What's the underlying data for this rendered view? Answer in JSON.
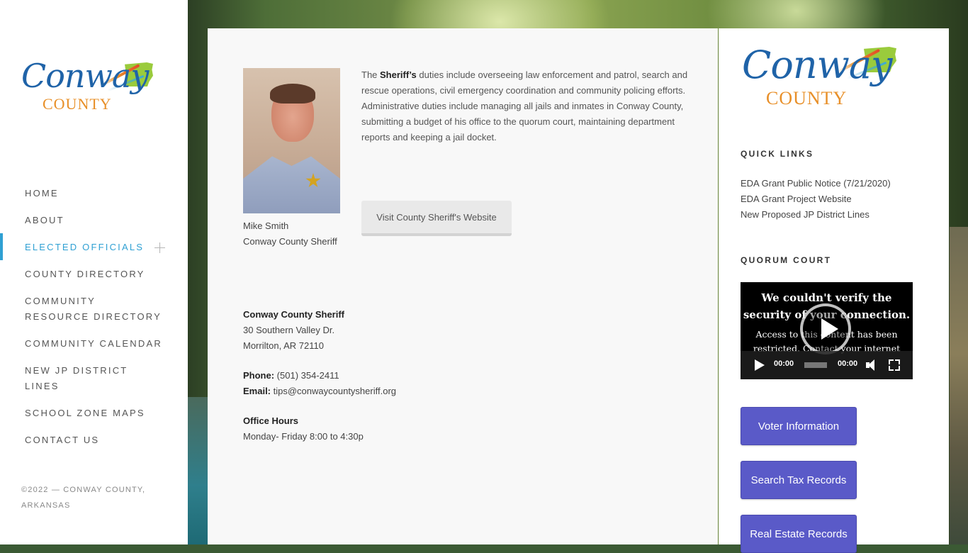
{
  "site": {
    "logo_script": "Conway",
    "logo_county": "COUNTY",
    "colors": {
      "accent": "#2fa0d3",
      "logo_blue": "#1f63a8",
      "logo_orange": "#e8902a",
      "button_blue": "#5a5ac8"
    }
  },
  "nav": {
    "items": [
      {
        "label": "HOME"
      },
      {
        "label": "ABOUT"
      },
      {
        "label": "ELECTED OFFICIALS",
        "active": true
      },
      {
        "label": "COUNTY DIRECTORY"
      },
      {
        "label": "COMMUNITY RESOURCE DIRECTORY"
      },
      {
        "label": "COMMUNITY CALENDAR"
      },
      {
        "label": "NEW JP DISTRICT LINES"
      },
      {
        "label": "SCHOOL ZONE MAPS"
      },
      {
        "label": "CONTACT US"
      }
    ]
  },
  "footer": {
    "copyright": "©2022 — CONWAY COUNTY, ARKANSAS"
  },
  "profile": {
    "name": "Mike Smith",
    "title": "Conway County Sheriff",
    "intro_prefix": "The ",
    "intro_bold": "Sheriff’s",
    "intro_rest": " duties include overseeing law enforcement and patrol, search and rescue operations, civil emergency coordination and community policing efforts. Administrative duties include managing all jails and inmates in Conway County, submitting a budget of his office to the quorum court, maintaining department reports and keeping a jail docket.",
    "visit_button": "Visit County Sheriff's Website"
  },
  "contact": {
    "office_name": "Conway County Sheriff",
    "address_line1": "30 Southern Valley Dr.",
    "address_line2": "Morrilton, AR 72110",
    "phone_label": "Phone:",
    "phone": " (501) 354-2411",
    "email_label": "Email:",
    "email": " tips@conwaycountysheriff.org",
    "hours_label": "Office Hours",
    "hours": "Monday- Friday 8:00 to 4:30p"
  },
  "quick_links": {
    "title": "QUICK LINKS",
    "items": [
      {
        "label": "EDA Grant Public Notice (7/21/2020)"
      },
      {
        "label": "EDA Grant Project Website"
      },
      {
        "label": "New Proposed JP District Lines"
      }
    ]
  },
  "quorum_court": {
    "title": "QUORUM COURT",
    "video_heading": "We couldn't verify the security of your connection.",
    "video_text": "Access to this content has been restricted. Contact your internet",
    "current_time": "00:00",
    "duration": "00:00"
  },
  "buttons": {
    "voter": "Voter Information",
    "tax": "Search Tax Records",
    "real_estate": "Real Estate Records"
  }
}
